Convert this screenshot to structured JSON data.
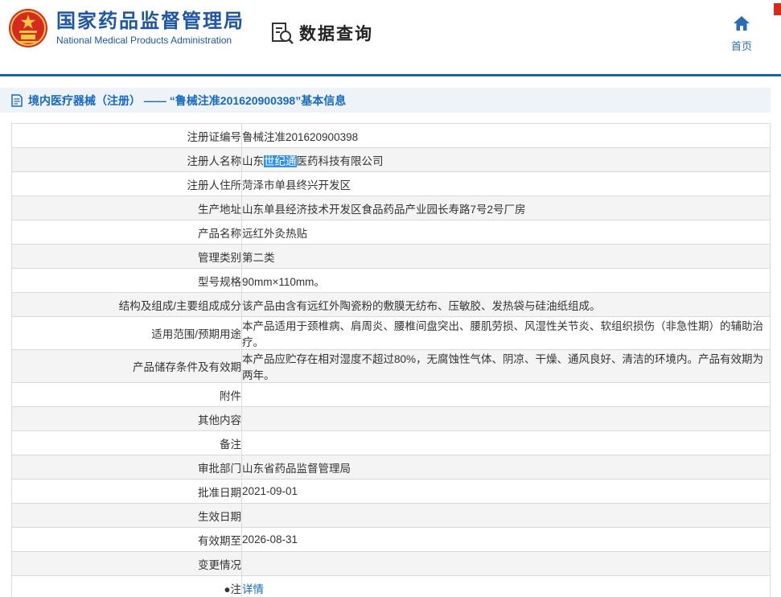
{
  "header": {
    "agency_cn": "国家药品监督管理局",
    "agency_en": "National Medical Products Administration",
    "section_title": "数据查询",
    "home_label": "首页"
  },
  "breadcrumb": {
    "text": "境内医疗器械（注册） —— “鲁械注准201620900398”基本信息"
  },
  "colors": {
    "accent_blue": "#1565ab",
    "link_blue": "#1769c0",
    "highlight_blue": "#3090f0",
    "emblem_red": "#d6291f",
    "emblem_gold": "#f7c843"
  },
  "table": {
    "rows": [
      {
        "label": "注册证编号",
        "value": "鲁械注准201620900398"
      },
      {
        "label": "注册人名称",
        "parts": [
          {
            "text": "山东"
          },
          {
            "text": "世纪通",
            "highlight": true
          },
          {
            "text": "医药科技有限公司"
          }
        ]
      },
      {
        "label": "注册人住所",
        "value": "菏泽市单县终兴开发区"
      },
      {
        "label": "生产地址",
        "value": "山东单县经济技术开发区食品药品产业园长寿路7号2号厂房"
      },
      {
        "label": "产品名称",
        "value": "远红外灸热贴"
      },
      {
        "label": "管理类别",
        "value": "第二类"
      },
      {
        "label": "型号规格",
        "value": "90mm×110mm。"
      },
      {
        "label": "结构及组成/主要组成成分",
        "value": "该产品由含有远红外陶瓷粉的敷膜无纺布、压敏胶、发热袋与硅油纸组成。"
      },
      {
        "label": "适用范围/预期用途",
        "value": "本产品适用于颈椎病、肩周炎、腰椎间盘突出、腰肌劳损、风湿性关节炎、软组织损伤（非急性期）的辅助治疗。"
      },
      {
        "label": "产品储存条件及有效期",
        "value": "本产品应贮存在相对湿度不超过80%，无腐蚀性气体、阴凉、干燥、通风良好、清洁的环境内。产品有效期为两年。"
      },
      {
        "label": "附件",
        "value": ""
      },
      {
        "label": "其他内容",
        "value": ""
      },
      {
        "label": "备注",
        "value": ""
      },
      {
        "label": "审批部门",
        "value": "山东省药品监督管理局"
      },
      {
        "label": "批准日期",
        "value": "2021-09-01"
      },
      {
        "label": "生效日期",
        "value": ""
      },
      {
        "label": "有效期至",
        "value": "2026-08-31"
      },
      {
        "label": "变更情况",
        "value": ""
      },
      {
        "label": "●注",
        "link": "详情"
      }
    ]
  }
}
